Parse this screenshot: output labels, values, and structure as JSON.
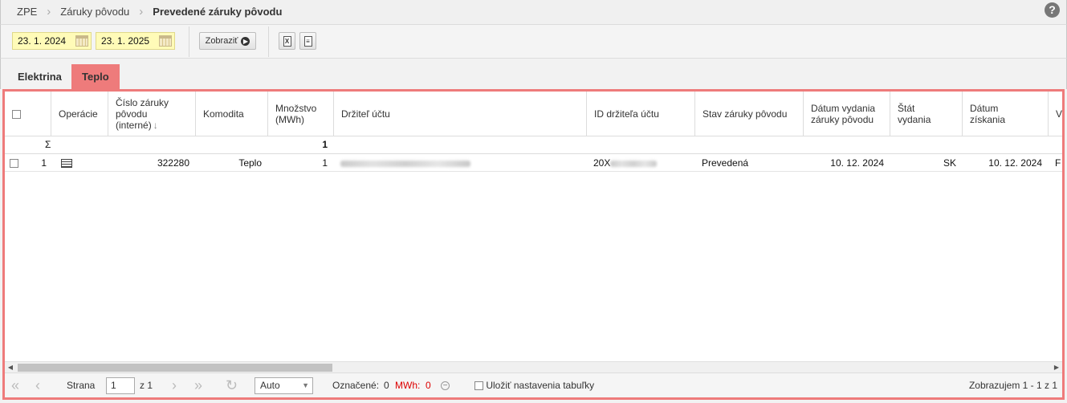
{
  "breadcrumb": {
    "items": [
      "ZPE",
      "Záruky pôvodu"
    ],
    "current": "Prevedené záruky pôvodu"
  },
  "help_icon": "?",
  "toolbar": {
    "date_from": "23. 1. 2024",
    "date_to": "23. 1. 2025",
    "show_label": "Zobraziť",
    "export_xls_glyph": "X",
    "export_doc_glyph": "≡"
  },
  "tabs": [
    {
      "label": "Elektrina",
      "active": false
    },
    {
      "label": "Teplo",
      "active": true
    }
  ],
  "table": {
    "headers": {
      "operations": "Operácie",
      "gid_1": "Číslo záruky",
      "gid_2": "pôvodu",
      "gid_3": "(interné)",
      "commodity": "Komodita",
      "amount_1": "Množstvo",
      "amount_2": "(MWh)",
      "holder": "Držiteľ účtu",
      "holder_id": "ID držiteľa účtu",
      "status": "Stav záruky pôvodu",
      "issue_date_1": "Dátum vydania",
      "issue_date_2": "záruky pôvodu",
      "country_1": "Štát",
      "country_2": "vydania",
      "acq_date_1": "Dátum",
      "acq_date_2": "získania",
      "next": "V"
    },
    "sort_indicator": "↓",
    "sum_symbol": "Σ",
    "sum_amount": "1",
    "rows": [
      {
        "num": "1",
        "gid": "322280",
        "commodity": "Teplo",
        "amount": "1",
        "holder_id_prefix": "20X",
        "status": "Prevedená",
        "issue_date": "10. 12. 2024",
        "country": "SK",
        "acq_date": "10. 12. 2024",
        "next": "F"
      }
    ]
  },
  "scrollbar": {
    "left_arrow": "◀",
    "right_arrow": "▶"
  },
  "pager": {
    "first": "«",
    "prev": "‹",
    "page_label": "Strana",
    "page_value": "1",
    "of_label": "z 1",
    "next": "›",
    "last": "»",
    "refresh": "↻",
    "page_size": "Auto",
    "marked_label": "Označené:",
    "marked_value": "0",
    "mwh_label": "MWh:",
    "mwh_value": "0",
    "save_settings_label": "Uložiť nastavenia tabuľky",
    "display_info": "Zobrazujem 1 - 1 z 1"
  },
  "colors": {
    "active_tab": "#ee7b7b",
    "grid_border": "#ee7b7b",
    "date_bg": "#fffbb8",
    "mwh_red": "#dd0000"
  }
}
